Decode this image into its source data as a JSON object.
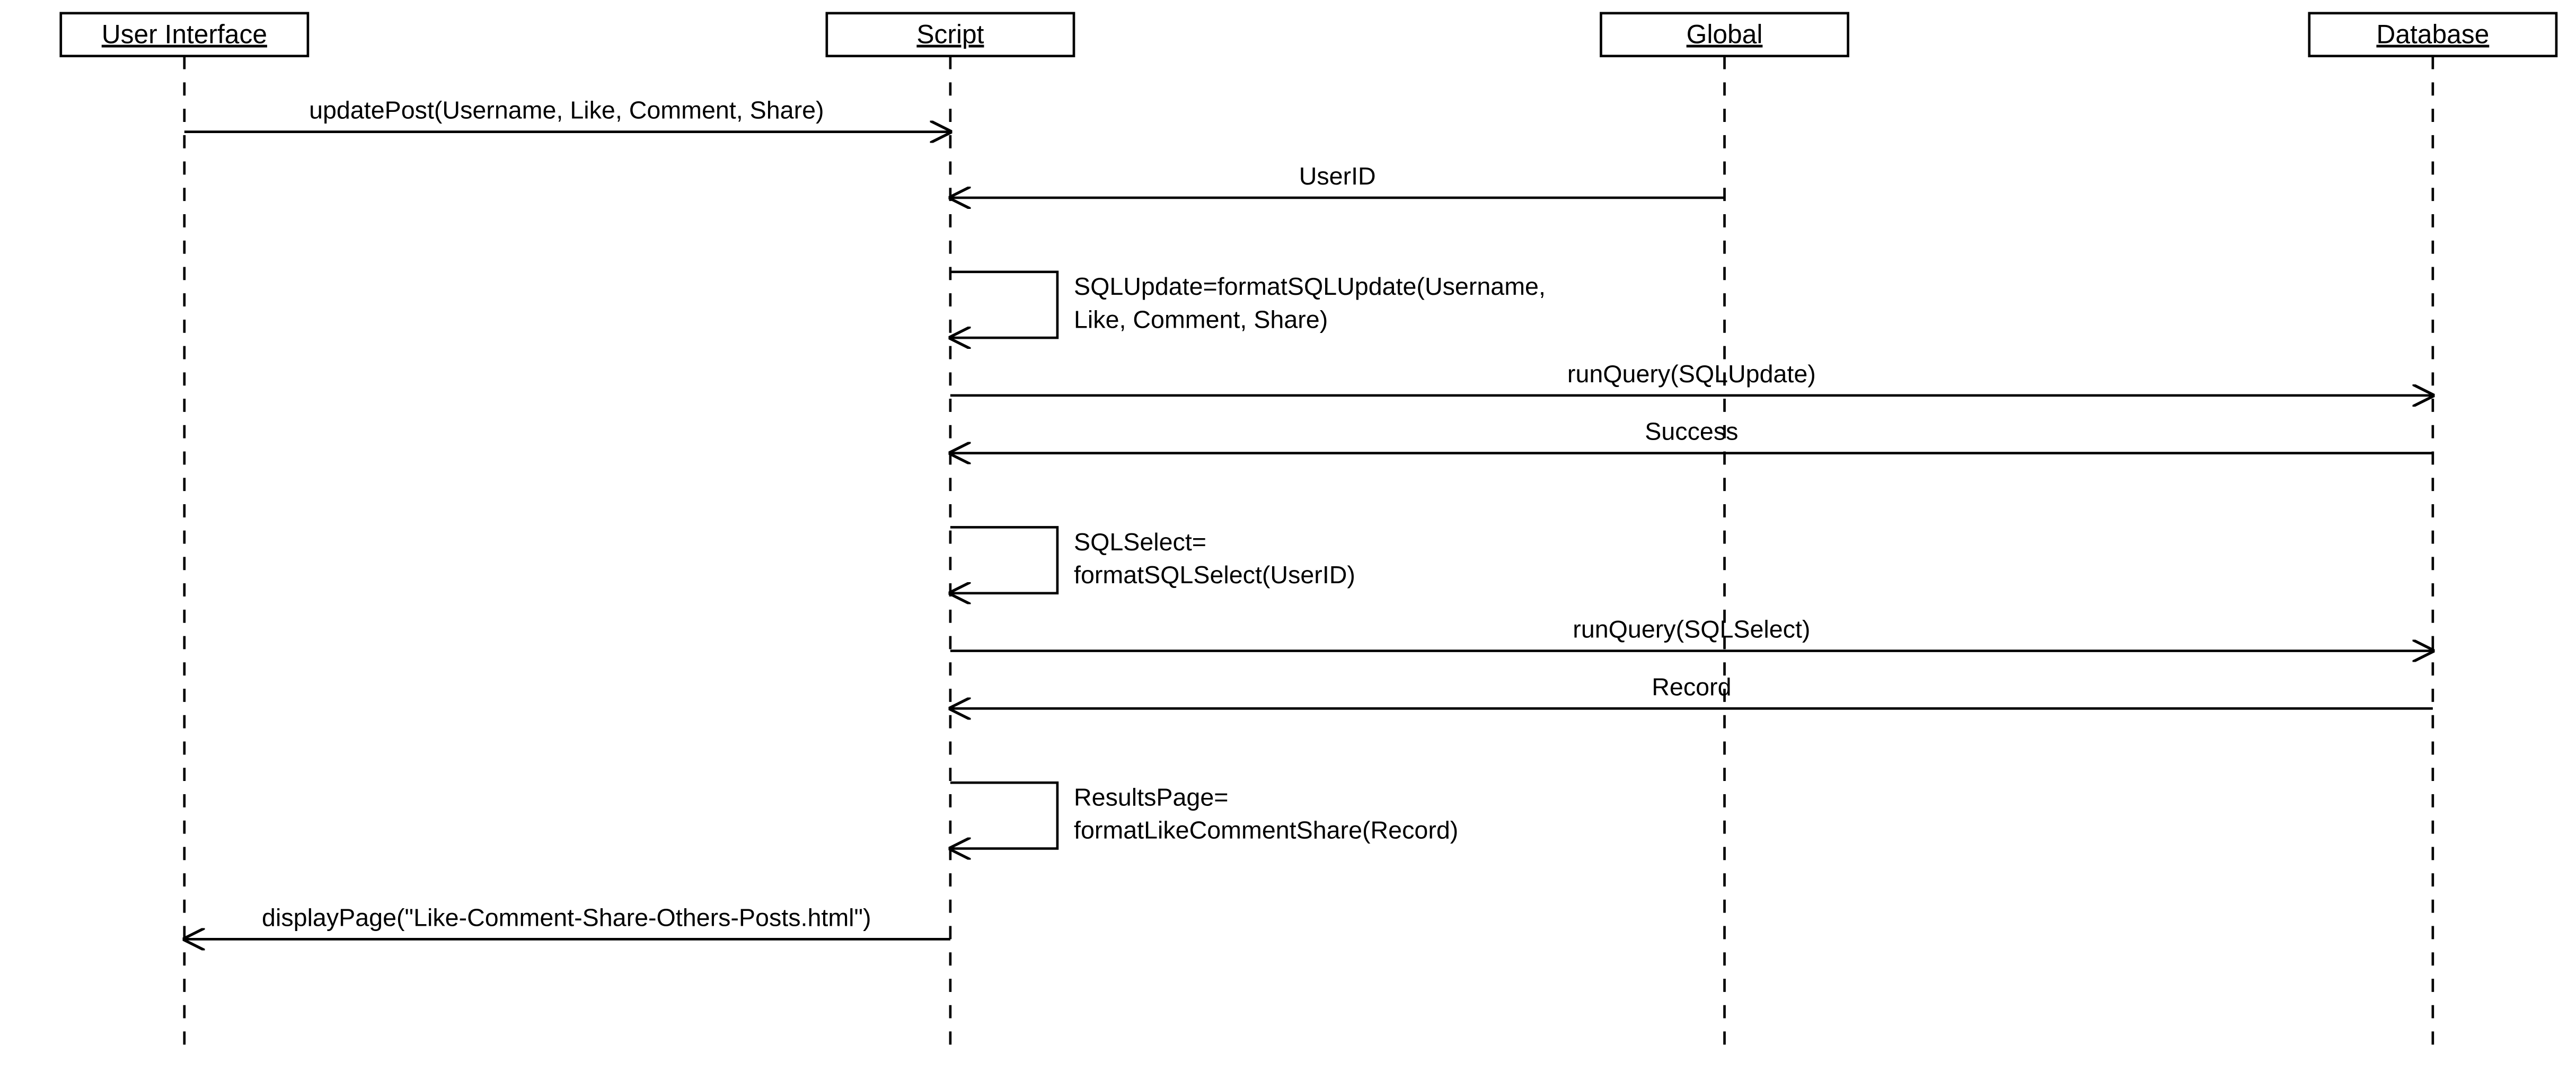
{
  "diagram": {
    "type": "uml-sequence",
    "participants": [
      {
        "id": "ui",
        "label": "User Interface"
      },
      {
        "id": "script",
        "label": "Script"
      },
      {
        "id": "global",
        "label": "Global"
      },
      {
        "id": "db",
        "label": "Database"
      }
    ],
    "messages": {
      "m1": "updatePost(Username, Like, Comment, Share)",
      "m2": "UserID",
      "m3a": "SQLUpdate=formatSQLUpdate(Username,",
      "m3b": " Like, Comment, Share)",
      "m4": "runQuery(SQLUpdate)",
      "m5": "Success",
      "m6a": "SQLSelect=",
      "m6b": "formatSQLSelect(UserID)",
      "m7": "runQuery(SQLSelect)",
      "m8": "Record",
      "m9a": "ResultsPage=",
      "m9b": "formatLikeCommentShare(Record)",
      "m10": "displayPage(\"Like-Comment-Share-Others-Posts.html\")"
    }
  }
}
